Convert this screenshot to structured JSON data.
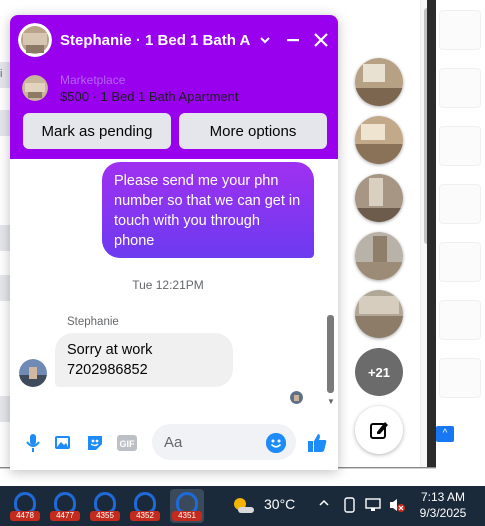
{
  "chat": {
    "title": "Stephanie · 1 Bed 1 Bath A...",
    "listing_label": "Marketplace",
    "listing_title": "$500 · 1 Bed 1 Bath Apartment",
    "mark_pending_label": "Mark as pending",
    "more_options_label": "More options",
    "outgoing_message": "Please send me your phn number so that we can get in touch with you through phone",
    "timestamp": "Tue 12:21PM",
    "sender_name": "Stephanie",
    "incoming_message": "Sorry at work 7202986852",
    "input_placeholder": "Aa"
  },
  "chat_heads": {
    "more_count": "+21"
  },
  "taskbar": {
    "apps": [
      "4478",
      "4477",
      "4355",
      "4352",
      "4351"
    ],
    "temperature": "30°C",
    "time": "7:13 AM",
    "date": "9/3/2025"
  },
  "colors": {
    "header_purple": "#9900ee",
    "bubble_start": "#a030f0",
    "bubble_end": "#6c3bf0",
    "accent_blue": "#1877f2",
    "taskbar": "#1b2a3a"
  }
}
